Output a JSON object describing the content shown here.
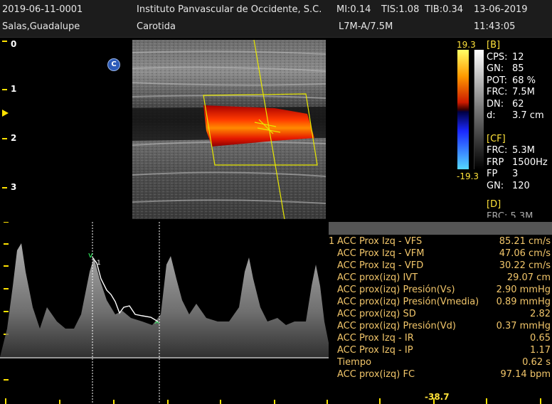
{
  "header": {
    "exam_id": "2019-06-11-0001",
    "institution": "Instituto Panvascular de Occidente, S.C.",
    "mi": "MI:0.14",
    "tis": "TIS:1.08",
    "tib": "TIB:0.34",
    "date": "13-06-2019",
    "patient": "Salas,Guadalupe",
    "study": "Carotida",
    "probe": "L7M-A/7.5M",
    "time": "11:43:05"
  },
  "depth_scale": [
    "0",
    "1",
    "2",
    "3"
  ],
  "orientation_badge": "C",
  "colorbar": {
    "max": "19.3",
    "min": "-19.3"
  },
  "params": {
    "b_header": "[B]",
    "b": [
      {
        "label": "CPS:",
        "value": "12"
      },
      {
        "label": "GN:",
        "value": "85"
      },
      {
        "label": "POT:",
        "value": "68 %"
      },
      {
        "label": "FRC:",
        "value": "7.5M"
      },
      {
        "label": "DN:",
        "value": "62"
      },
      {
        "label": "d:",
        "value": "3.7 cm"
      }
    ],
    "cf_header": "[CF]",
    "cf": [
      {
        "label": "FRC:",
        "value": "5.3M"
      },
      {
        "label": "FRP",
        "value": "1500Hz"
      },
      {
        "label": "FP",
        "value": "3"
      },
      {
        "label": "GN:",
        "value": "120"
      }
    ],
    "d_header": "[D]",
    "d_partial": "FRC: 5.3M"
  },
  "measurements": [
    {
      "n": "1",
      "label": "ACC Prox Izq - VFS",
      "value": "85.21 cm/s"
    },
    {
      "n": "",
      "label": "ACC Prox Izq - VFM",
      "value": "47.06 cm/s"
    },
    {
      "n": "",
      "label": "ACC Prox Izq - VFD",
      "value": "30.22 cm/s"
    },
    {
      "n": "",
      "label": "ACC prox(izq) IVT",
      "value": "29.07 cm"
    },
    {
      "n": "",
      "label": "ACC prox(izq) Presión(Vs)",
      "value": "2.90 mmHg"
    },
    {
      "n": "",
      "label": "ACC prox(izq) Presión(Vmedia)",
      "value": "0.89 mmHg"
    },
    {
      "n": "",
      "label": "ACC prox(izq) SD",
      "value": "2.82"
    },
    {
      "n": "",
      "label": "ACC prox(izq) Presión(Vd)",
      "value": "0.37 mmHg"
    },
    {
      "n": "",
      "label": "ACC Prox Izq - IR",
      "value": "0.65"
    },
    {
      "n": "",
      "label": "ACC Prox Izq - IP",
      "value": "1.17"
    },
    {
      "n": "",
      "label": "Tiempo",
      "value": "0.62 s"
    },
    {
      "n": "",
      "label": "ACC prox(izq) FC",
      "value": "97.14 bpm"
    }
  ],
  "doppler_scale_readout": "-38.7",
  "colors": {
    "accent_yellow": "#ffe23a",
    "measure_orange": "#f2c66a",
    "header_bg": "#1c1c1c"
  }
}
